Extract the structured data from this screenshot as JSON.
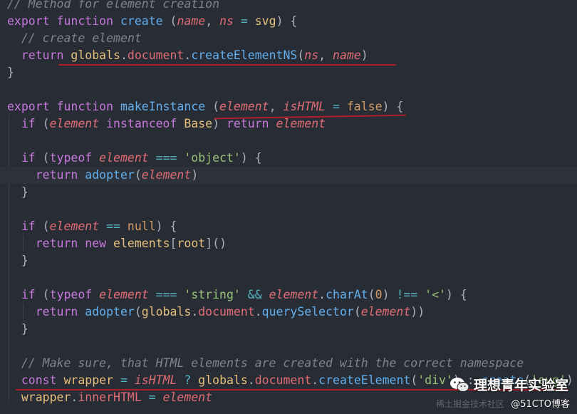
{
  "code_lines": [
    [
      {
        "t": "// Method for element creation",
        "c": "#7f848e",
        "i": true
      }
    ],
    [
      {
        "t": "export ",
        "c": "#c678dd"
      },
      {
        "t": "function ",
        "c": "#c678dd"
      },
      {
        "t": "create ",
        "c": "#61afef"
      },
      {
        "t": "(",
        "c": "#abb2bf"
      },
      {
        "t": "name",
        "c": "#e06c75",
        "i": true
      },
      {
        "t": ", ",
        "c": "#abb2bf"
      },
      {
        "t": "ns",
        "c": "#e06c75",
        "i": true
      },
      {
        "t": " = ",
        "c": "#56b6c2"
      },
      {
        "t": "svg",
        "c": "#e5c07b"
      },
      {
        "t": ") {",
        "c": "#abb2bf"
      }
    ],
    [
      {
        "t": "  // create element",
        "c": "#7f848e",
        "i": true
      }
    ],
    [
      {
        "t": "  return ",
        "c": "#c678dd"
      },
      {
        "t": "globals",
        "c": "#e5c07b"
      },
      {
        "t": ".",
        "c": "#abb2bf"
      },
      {
        "t": "document",
        "c": "#e06c75"
      },
      {
        "t": ".",
        "c": "#abb2bf"
      },
      {
        "t": "createElementNS",
        "c": "#61afef"
      },
      {
        "t": "(",
        "c": "#abb2bf"
      },
      {
        "t": "ns",
        "c": "#e06c75",
        "i": true
      },
      {
        "t": ", ",
        "c": "#abb2bf"
      },
      {
        "t": "name",
        "c": "#e06c75",
        "i": true
      },
      {
        "t": ")",
        "c": "#abb2bf"
      }
    ],
    [
      {
        "t": "}",
        "c": "#abb2bf"
      }
    ],
    [],
    [
      {
        "t": "export ",
        "c": "#c678dd"
      },
      {
        "t": "function ",
        "c": "#c678dd"
      },
      {
        "t": "makeInstance ",
        "c": "#61afef"
      },
      {
        "t": "(",
        "c": "#abb2bf"
      },
      {
        "t": "element",
        "c": "#e06c75",
        "i": true
      },
      {
        "t": ", ",
        "c": "#abb2bf"
      },
      {
        "t": "isHTML",
        "c": "#e06c75",
        "i": true
      },
      {
        "t": " = ",
        "c": "#56b6c2"
      },
      {
        "t": "false",
        "c": "#d19a66"
      },
      {
        "t": ") {",
        "c": "#abb2bf"
      }
    ],
    [
      {
        "t": "  if ",
        "c": "#c678dd"
      },
      {
        "t": "(",
        "c": "#abb2bf"
      },
      {
        "t": "element",
        "c": "#e06c75",
        "i": true
      },
      {
        "t": " instanceof ",
        "c": "#c678dd"
      },
      {
        "t": "Base",
        "c": "#e5c07b"
      },
      {
        "t": ") ",
        "c": "#abb2bf"
      },
      {
        "t": "return ",
        "c": "#c678dd"
      },
      {
        "t": "element",
        "c": "#e06c75",
        "i": true
      }
    ],
    [],
    [
      {
        "t": "  if ",
        "c": "#c678dd"
      },
      {
        "t": "(",
        "c": "#abb2bf"
      },
      {
        "t": "typeof ",
        "c": "#c678dd"
      },
      {
        "t": "element",
        "c": "#e06c75",
        "i": true
      },
      {
        "t": " === ",
        "c": "#56b6c2"
      },
      {
        "t": "'object'",
        "c": "#98c379"
      },
      {
        "t": ") {",
        "c": "#abb2bf"
      }
    ],
    [
      {
        "t": "    return ",
        "c": "#c678dd"
      },
      {
        "t": "adopter",
        "c": "#61afef"
      },
      {
        "t": "(",
        "c": "#abb2bf"
      },
      {
        "t": "element",
        "c": "#e06c75",
        "i": true
      },
      {
        "t": ")",
        "c": "#abb2bf"
      }
    ],
    [
      {
        "t": "  }",
        "c": "#abb2bf"
      }
    ],
    [],
    [
      {
        "t": "  if ",
        "c": "#c678dd"
      },
      {
        "t": "(",
        "c": "#abb2bf"
      },
      {
        "t": "element",
        "c": "#e06c75",
        "i": true
      },
      {
        "t": " == ",
        "c": "#56b6c2"
      },
      {
        "t": "null",
        "c": "#d19a66"
      },
      {
        "t": ") {",
        "c": "#abb2bf"
      }
    ],
    [
      {
        "t": "    return ",
        "c": "#c678dd"
      },
      {
        "t": "new ",
        "c": "#c678dd"
      },
      {
        "t": "elements",
        "c": "#e5c07b"
      },
      {
        "t": "[",
        "c": "#abb2bf"
      },
      {
        "t": "root",
        "c": "#e5c07b"
      },
      {
        "t": "]",
        "c": "#abb2bf"
      },
      {
        "t": "()",
        "c": "#abb2bf"
      }
    ],
    [
      {
        "t": "  }",
        "c": "#abb2bf"
      }
    ],
    [],
    [
      {
        "t": "  if ",
        "c": "#c678dd"
      },
      {
        "t": "(",
        "c": "#abb2bf"
      },
      {
        "t": "typeof ",
        "c": "#c678dd"
      },
      {
        "t": "element",
        "c": "#e06c75",
        "i": true
      },
      {
        "t": " === ",
        "c": "#56b6c2"
      },
      {
        "t": "'string'",
        "c": "#98c379"
      },
      {
        "t": " && ",
        "c": "#56b6c2"
      },
      {
        "t": "element",
        "c": "#e06c75",
        "i": true
      },
      {
        "t": ".",
        "c": "#abb2bf"
      },
      {
        "t": "charAt",
        "c": "#61afef"
      },
      {
        "t": "(",
        "c": "#abb2bf"
      },
      {
        "t": "0",
        "c": "#d19a66"
      },
      {
        "t": ")",
        "c": "#abb2bf"
      },
      {
        "t": " !== ",
        "c": "#56b6c2"
      },
      {
        "t": "'<'",
        "c": "#98c379"
      },
      {
        "t": ") {",
        "c": "#abb2bf"
      }
    ],
    [
      {
        "t": "    return ",
        "c": "#c678dd"
      },
      {
        "t": "adopter",
        "c": "#61afef"
      },
      {
        "t": "(",
        "c": "#abb2bf"
      },
      {
        "t": "globals",
        "c": "#e5c07b"
      },
      {
        "t": ".",
        "c": "#abb2bf"
      },
      {
        "t": "document",
        "c": "#e06c75"
      },
      {
        "t": ".",
        "c": "#abb2bf"
      },
      {
        "t": "querySelector",
        "c": "#61afef"
      },
      {
        "t": "(",
        "c": "#abb2bf"
      },
      {
        "t": "element",
        "c": "#e06c75",
        "i": true
      },
      {
        "t": "))",
        "c": "#abb2bf"
      }
    ],
    [
      {
        "t": "  }",
        "c": "#abb2bf"
      }
    ],
    [],
    [
      {
        "t": "  // Make sure, that HTML elements are created with the correct namespace",
        "c": "#7f848e",
        "i": true
      }
    ],
    [
      {
        "t": "  const ",
        "c": "#c678dd"
      },
      {
        "t": "wrapper",
        "c": "#e5c07b"
      },
      {
        "t": " = ",
        "c": "#56b6c2"
      },
      {
        "t": "isHTML",
        "c": "#e06c75",
        "i": true
      },
      {
        "t": " ? ",
        "c": "#56b6c2"
      },
      {
        "t": "globals",
        "c": "#e5c07b"
      },
      {
        "t": ".",
        "c": "#abb2bf"
      },
      {
        "t": "document",
        "c": "#e06c75"
      },
      {
        "t": ".",
        "c": "#abb2bf"
      },
      {
        "t": "createElement",
        "c": "#61afef"
      },
      {
        "t": "(",
        "c": "#abb2bf"
      },
      {
        "t": "'div'",
        "c": "#98c379"
      },
      {
        "t": ") : ",
        "c": "#abb2bf"
      },
      {
        "t": "create",
        "c": "#61afef"
      },
      {
        "t": "(",
        "c": "#abb2bf"
      },
      {
        "t": "'svg'",
        "c": "#98c379"
      },
      {
        "t": ")",
        "c": "#abb2bf"
      }
    ],
    [
      {
        "t": "  wrapper",
        "c": "#e5c07b"
      },
      {
        "t": ".",
        "c": "#abb2bf"
      },
      {
        "t": "innerHTML",
        "c": "#e06c75"
      },
      {
        "t": " = ",
        "c": "#56b6c2"
      },
      {
        "t": "element",
        "c": "#e06c75",
        "i": true
      }
    ]
  ],
  "watermark": {
    "title": "理想青年实验室",
    "subtitle": "@51CTO博客",
    "faint": "稀土掘金技术社区"
  }
}
